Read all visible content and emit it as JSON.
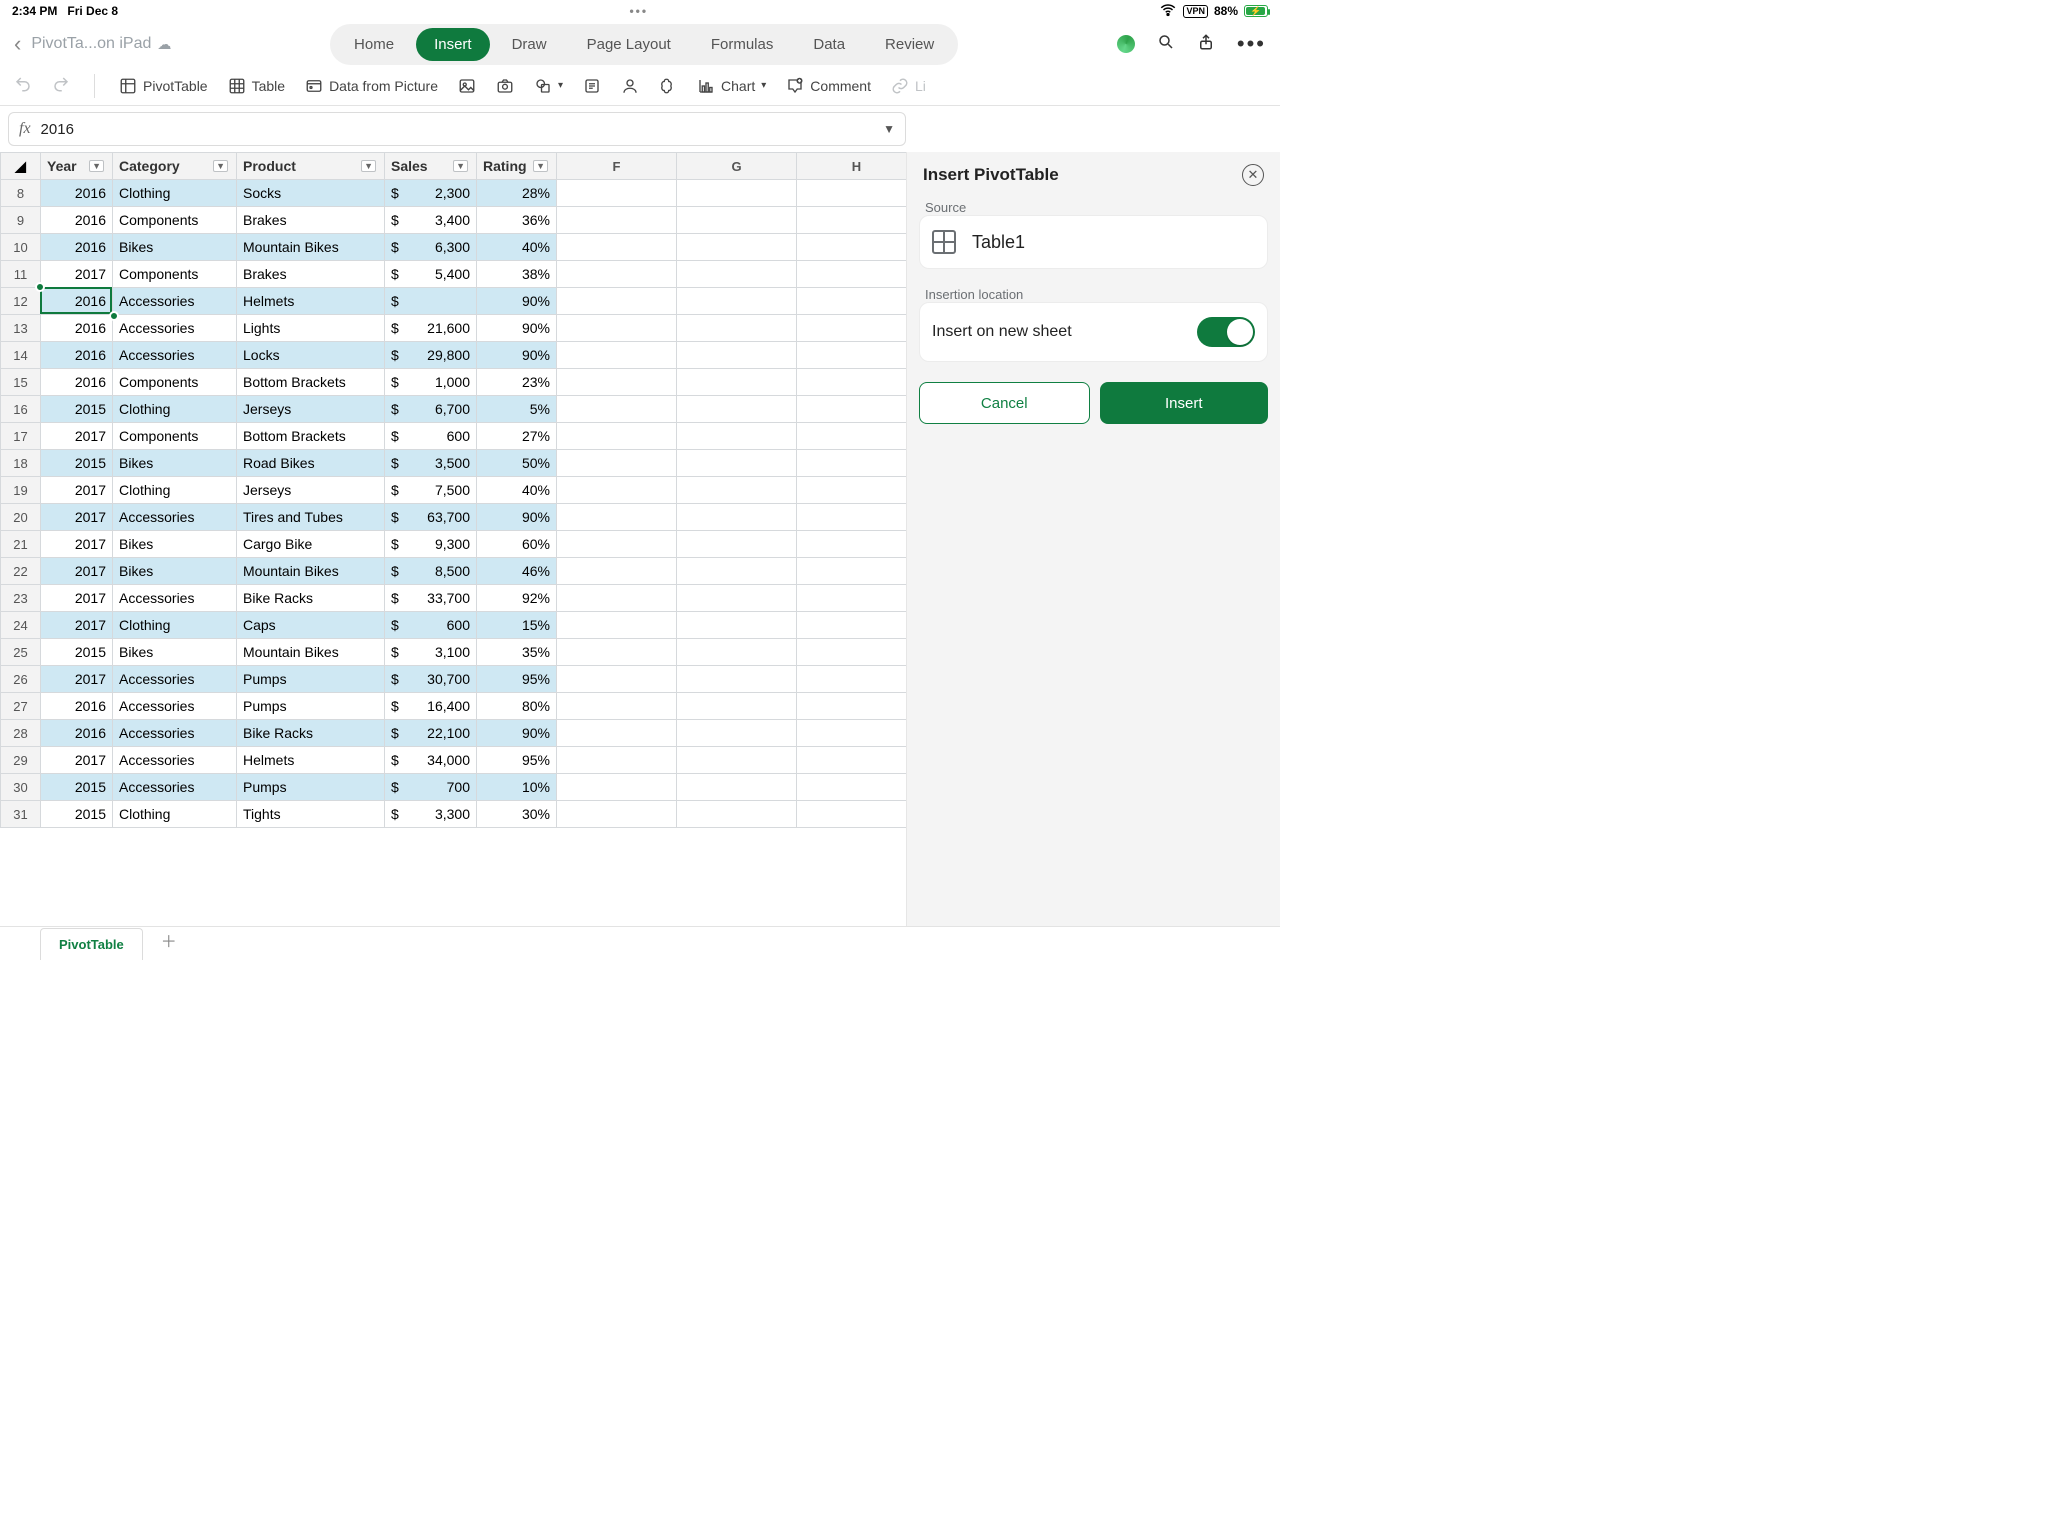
{
  "status": {
    "time": "2:34 PM",
    "date": "Fri Dec 8",
    "center": "•••",
    "vpn": "VPN",
    "battery_pct": "88%"
  },
  "doc": {
    "title": "PivotTa...on iPad"
  },
  "ribbon": {
    "tabs": [
      "Home",
      "Insert",
      "Draw",
      "Page Layout",
      "Formulas",
      "Data",
      "Review"
    ],
    "active_index": 1
  },
  "toolbar": {
    "pivot": "PivotTable",
    "table": "Table",
    "data_picture": "Data from Picture",
    "chart": "Chart",
    "comment": "Comment",
    "link": "Li"
  },
  "formula": {
    "fx": "fx",
    "value": "2016"
  },
  "columns": {
    "headers": [
      "Year",
      "Category",
      "Product",
      "Sales",
      "Rating"
    ],
    "extra_letters": [
      "F",
      "G",
      "H"
    ]
  },
  "rows": [
    {
      "n": 8,
      "year": "2016",
      "category": "Clothing",
      "product": "Socks",
      "sales": "2,300",
      "rating": "28%"
    },
    {
      "n": 9,
      "year": "2016",
      "category": "Components",
      "product": "Brakes",
      "sales": "3,400",
      "rating": "36%"
    },
    {
      "n": 10,
      "year": "2016",
      "category": "Bikes",
      "product": "Mountain Bikes",
      "sales": "6,300",
      "rating": "40%"
    },
    {
      "n": 11,
      "year": "2017",
      "category": "Components",
      "product": "Brakes",
      "sales": "5,400",
      "rating": "38%"
    },
    {
      "n": 12,
      "year": "2016",
      "category": "Accessories",
      "product": "Helmets",
      "sales": "",
      "rating": "90%"
    },
    {
      "n": 13,
      "year": "2016",
      "category": "Accessories",
      "product": "Lights",
      "sales": "21,600",
      "rating": "90%"
    },
    {
      "n": 14,
      "year": "2016",
      "category": "Accessories",
      "product": "Locks",
      "sales": "29,800",
      "rating": "90%"
    },
    {
      "n": 15,
      "year": "2016",
      "category": "Components",
      "product": "Bottom Brackets",
      "sales": "1,000",
      "rating": "23%"
    },
    {
      "n": 16,
      "year": "2015",
      "category": "Clothing",
      "product": "Jerseys",
      "sales": "6,700",
      "rating": "5%"
    },
    {
      "n": 17,
      "year": "2017",
      "category": "Components",
      "product": "Bottom Brackets",
      "sales": "600",
      "rating": "27%"
    },
    {
      "n": 18,
      "year": "2015",
      "category": "Bikes",
      "product": "Road Bikes",
      "sales": "3,500",
      "rating": "50%"
    },
    {
      "n": 19,
      "year": "2017",
      "category": "Clothing",
      "product": "Jerseys",
      "sales": "7,500",
      "rating": "40%"
    },
    {
      "n": 20,
      "year": "2017",
      "category": "Accessories",
      "product": "Tires and Tubes",
      "sales": "63,700",
      "rating": "90%"
    },
    {
      "n": 21,
      "year": "2017",
      "category": "Bikes",
      "product": "Cargo Bike",
      "sales": "9,300",
      "rating": "60%"
    },
    {
      "n": 22,
      "year": "2017",
      "category": "Bikes",
      "product": "Mountain Bikes",
      "sales": "8,500",
      "rating": "46%"
    },
    {
      "n": 23,
      "year": "2017",
      "category": "Accessories",
      "product": "Bike Racks",
      "sales": "33,700",
      "rating": "92%"
    },
    {
      "n": 24,
      "year": "2017",
      "category": "Clothing",
      "product": "Caps",
      "sales": "600",
      "rating": "15%"
    },
    {
      "n": 25,
      "year": "2015",
      "category": "Bikes",
      "product": "Mountain Bikes",
      "sales": "3,100",
      "rating": "35%"
    },
    {
      "n": 26,
      "year": "2017",
      "category": "Accessories",
      "product": "Pumps",
      "sales": "30,700",
      "rating": "95%"
    },
    {
      "n": 27,
      "year": "2016",
      "category": "Accessories",
      "product": "Pumps",
      "sales": "16,400",
      "rating": "80%"
    },
    {
      "n": 28,
      "year": "2016",
      "category": "Accessories",
      "product": "Bike Racks",
      "sales": "22,100",
      "rating": "90%"
    },
    {
      "n": 29,
      "year": "2017",
      "category": "Accessories",
      "product": "Helmets",
      "sales": "34,000",
      "rating": "95%"
    },
    {
      "n": 30,
      "year": "2015",
      "category": "Accessories",
      "product": "Pumps",
      "sales": "700",
      "rating": "10%"
    },
    {
      "n": 31,
      "year": "2015",
      "category": "Clothing",
      "product": "Tights",
      "sales": "3,300",
      "rating": "30%"
    }
  ],
  "selection": {
    "row_n": 12,
    "col": 0
  },
  "side": {
    "title": "Insert PivotTable",
    "source_label": "Source",
    "source_name": "Table1",
    "location_label": "Insertion location",
    "insert_new_sheet": "Insert on new sheet",
    "cancel": "Cancel",
    "insert": "Insert"
  },
  "sheet_tabs": {
    "active": "PivotTable"
  }
}
